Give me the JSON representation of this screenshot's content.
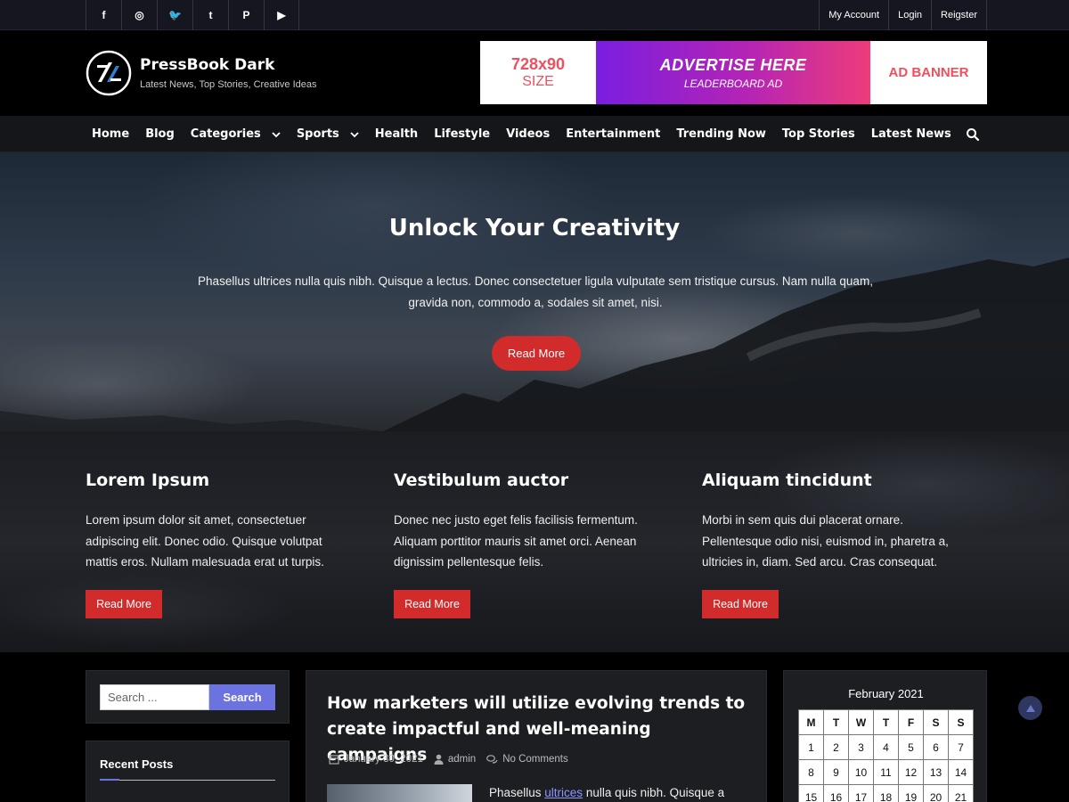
{
  "topbar": {
    "social": [
      {
        "name": "facebook-icon",
        "glyph": "f"
      },
      {
        "name": "instagram-icon",
        "glyph": "◎"
      },
      {
        "name": "twitter-icon",
        "glyph": "🐦"
      },
      {
        "name": "tumblr-icon",
        "glyph": "t"
      },
      {
        "name": "pinterest-icon",
        "glyph": "P"
      },
      {
        "name": "youtube-icon",
        "glyph": "▶"
      }
    ],
    "account_links": [
      "My Account",
      "Login",
      "Reigster"
    ]
  },
  "header": {
    "site_title": "PressBook Dark",
    "tagline": "Latest News, Top Stories, Creative Ideas"
  },
  "ad": {
    "size_line1": "728x90",
    "size_line2": "SIZE",
    "headline": "ADVERTISE HERE",
    "subline": "LEADERBOARD AD",
    "banner": "AD BANNER"
  },
  "nav": {
    "items": [
      {
        "label": "Home",
        "dropdown": false
      },
      {
        "label": "Blog",
        "dropdown": false
      },
      {
        "label": "Categories",
        "dropdown": true
      },
      {
        "label": "Sports",
        "dropdown": true
      },
      {
        "label": "Health",
        "dropdown": false
      },
      {
        "label": "Lifestyle",
        "dropdown": false
      },
      {
        "label": "Videos",
        "dropdown": false
      },
      {
        "label": "Entertainment",
        "dropdown": false
      },
      {
        "label": "Trending Now",
        "dropdown": false
      },
      {
        "label": "Top Stories",
        "dropdown": false
      },
      {
        "label": "Latest News",
        "dropdown": false
      }
    ]
  },
  "hero": {
    "title": "Unlock Your Creativity",
    "text": "Phasellus ultrices nulla quis nibh. Quisque a lectus. Donec consectetuer ligula vulputate sem tristique cursus. Nam nulla quam, gravida non, commodo a, sodales sit amet, nisi.",
    "button": "Read More"
  },
  "features": [
    {
      "title": "Lorem Ipsum",
      "text": "Lorem ipsum dolor sit amet, consectetuer adipiscing elit. Donec odio. Quisque volutpat mattis eros. Nullam malesuada erat ut turpis.",
      "button": "Read More"
    },
    {
      "title": "Vestibulum auctor",
      "text": "Donec nec justo eget felis facilisis fermentum. Aliquam porttitor mauris sit amet orci. Aenean dignissim pellentesque felis.",
      "button": "Read More"
    },
    {
      "title": "Aliquam tincidunt",
      "text": "Morbi in sem quis dui placerat ornare. Pellentesque odio nisi, euismod in, pharetra a, ultricies in, diam. Sed arcu. Cras consequat.",
      "button": "Read More"
    }
  ],
  "sidebar": {
    "search_placeholder": "Search ...",
    "search_button": "Search",
    "recent_posts_title": "Recent Posts"
  },
  "post": {
    "title": "How marketers will utilize evolving trends to create impactful and well-meaning campaigns",
    "date": "January 30, 2021",
    "author": "admin",
    "comments": "No Comments",
    "excerpt_before": "Phasellus ",
    "excerpt_link": "ultrices",
    "excerpt_after": " nulla quis nibh. Quisque a"
  },
  "calendar": {
    "title": "February 2021",
    "headers": [
      "M",
      "T",
      "W",
      "T",
      "F",
      "S",
      "S"
    ],
    "rows": [
      [
        "1",
        "2",
        "3",
        "4",
        "5",
        "6",
        "7"
      ],
      [
        "8",
        "9",
        "10",
        "11",
        "12",
        "13",
        "14"
      ],
      [
        "15",
        "16",
        "17",
        "18",
        "19",
        "20",
        "21"
      ]
    ]
  },
  "colors": {
    "accent_red": "#d22b2b",
    "accent_blue": "#6c72e0",
    "background": "#000000"
  }
}
